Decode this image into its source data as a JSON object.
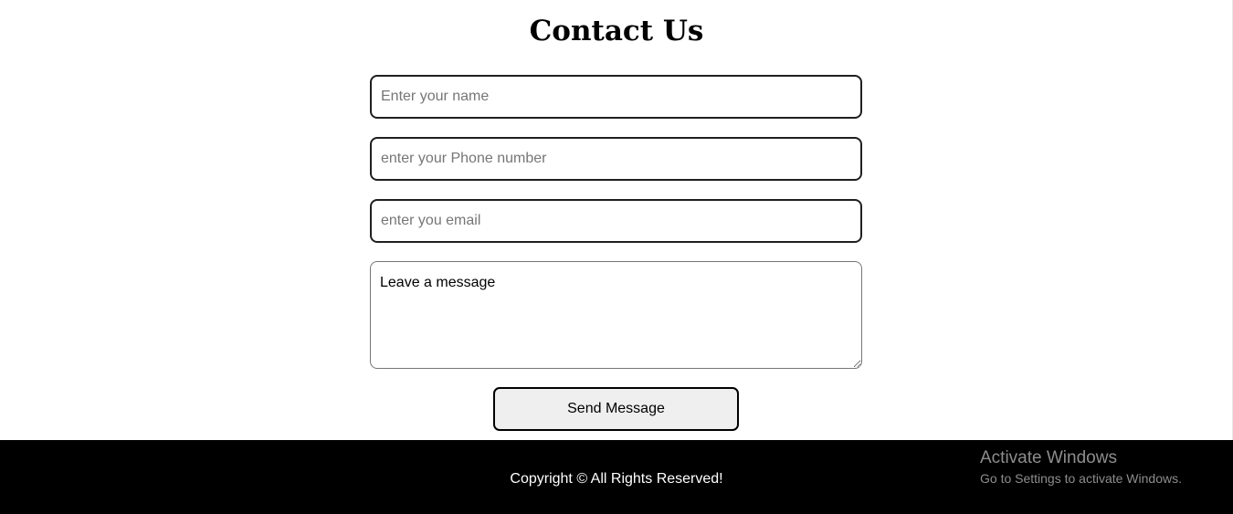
{
  "page": {
    "title": "Contact Us"
  },
  "form": {
    "name_placeholder": "Enter your name",
    "phone_placeholder": "enter your Phone number",
    "email_placeholder": "enter you email",
    "message_placeholder": "Leave a message",
    "submit_label": "Send Message"
  },
  "footer": {
    "copyright": "Copyright © All Rights Reserved!"
  },
  "os_watermark": {
    "title": "Activate Windows",
    "subtitle": "Go to Settings to activate Windows."
  },
  "colors": {
    "footer_bg": "#000000",
    "button_bg": "#efefef",
    "watermark_text": "#8d8d8d"
  }
}
